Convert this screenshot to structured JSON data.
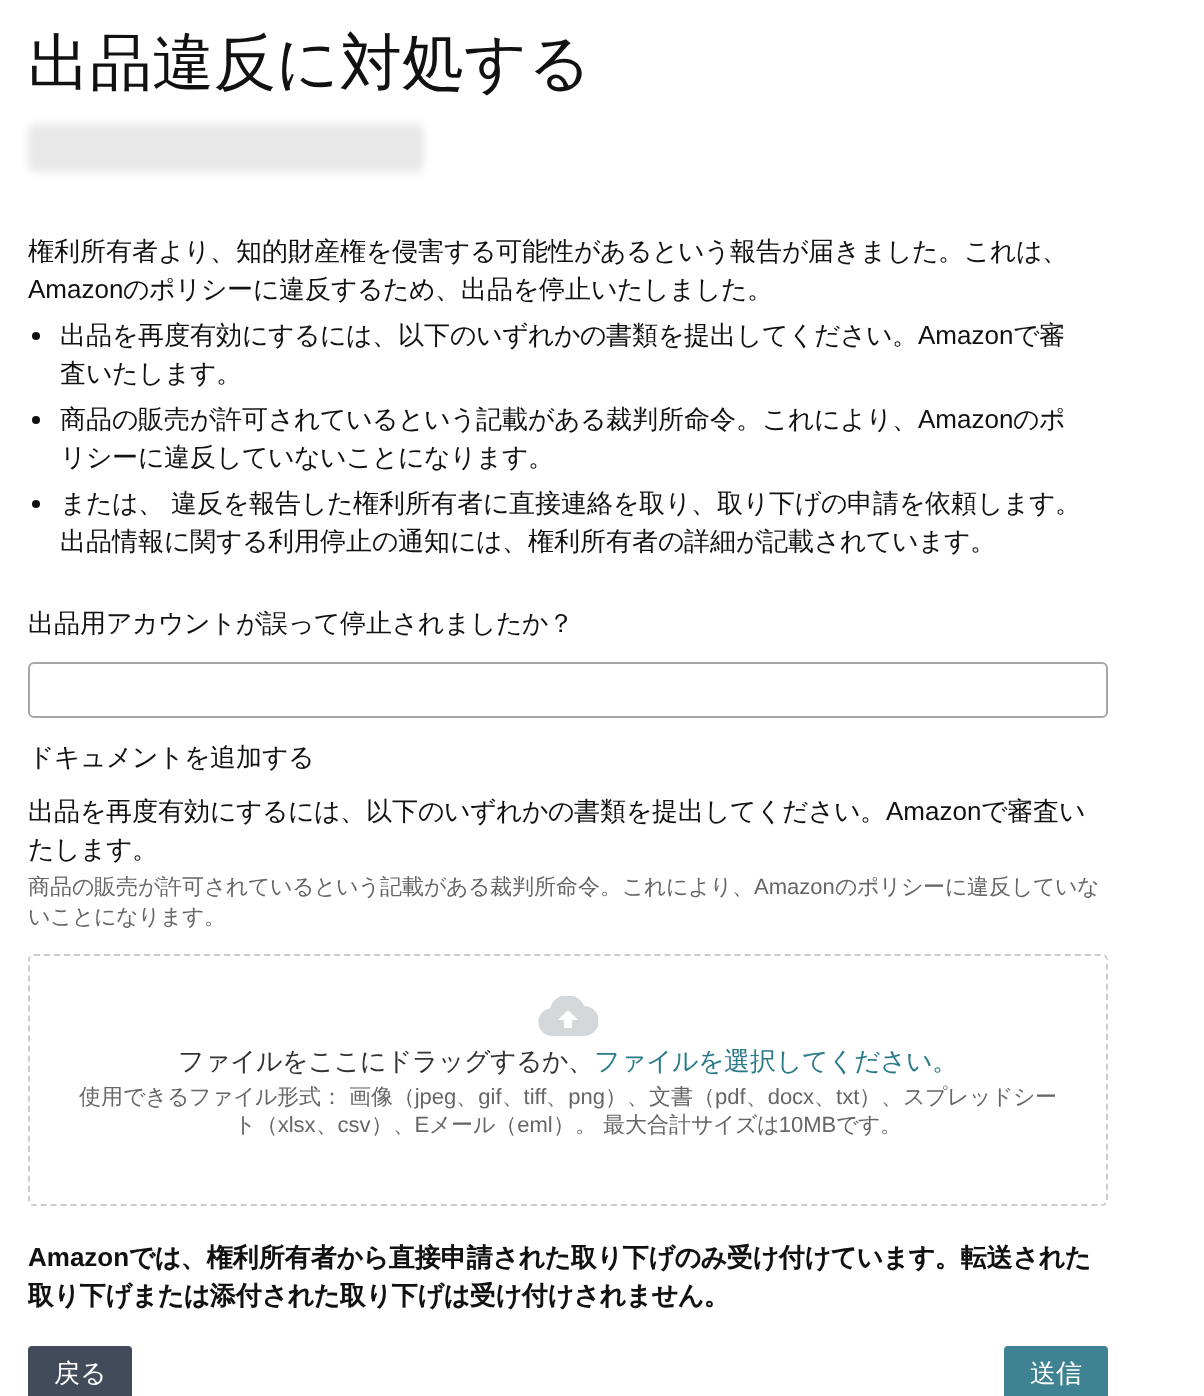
{
  "title": "出品違反に対処する",
  "intro": "権利所有者より、知的財産権を侵害する可能性があるという報告が届きました。これは、Amazonのポリシーに違反するため、出品を停止いたしました。",
  "bullets": [
    "出品を再度有効にするには、以下のいずれかの書類を提出してください。Amazonで審査いたします。",
    "商品の販売が許可されているという記載がある裁判所命令。これにより、Amazonのポリシーに違反していないことになります。",
    "または、 違反を報告した権利所有者に直接連絡を取り、取り下げの申請を依頼します。出品情報に関する利用停止の通知には、権利所有者の詳細が記載されています。"
  ],
  "question": {
    "label": "出品用アカウントが誤って停止されましたか？"
  },
  "documents": {
    "heading": "ドキュメントを追加する",
    "description": "出品を再度有効にするには、以下のいずれかの書類を提出してください。Amazonで審査いたします。",
    "hint": "商品の販売が許可されているという記載がある裁判所命令。これにより、Amazonのポリシーに違反していないことになります。"
  },
  "dropzone": {
    "prompt": "ファイルをここにドラッグするか、",
    "link": "ファイルを選択してください。",
    "formats": "使用できるファイル形式： 画像（jpeg、gif、tiff、png）、文書（pdf、docx、txt）、スプレッドシート（xlsx、csv）、Eメール（eml）。 最大合計サイズは10MBです。"
  },
  "notice": "Amazonでは、権利所有者から直接申請された取り下げのみ受け付けています。転送された取り下げまたは添付された取り下げは受け付けされません。",
  "buttons": [
    {
      "label": "戻る",
      "kind": "back"
    },
    {
      "label": "送信",
      "kind": "submit"
    }
  ]
}
